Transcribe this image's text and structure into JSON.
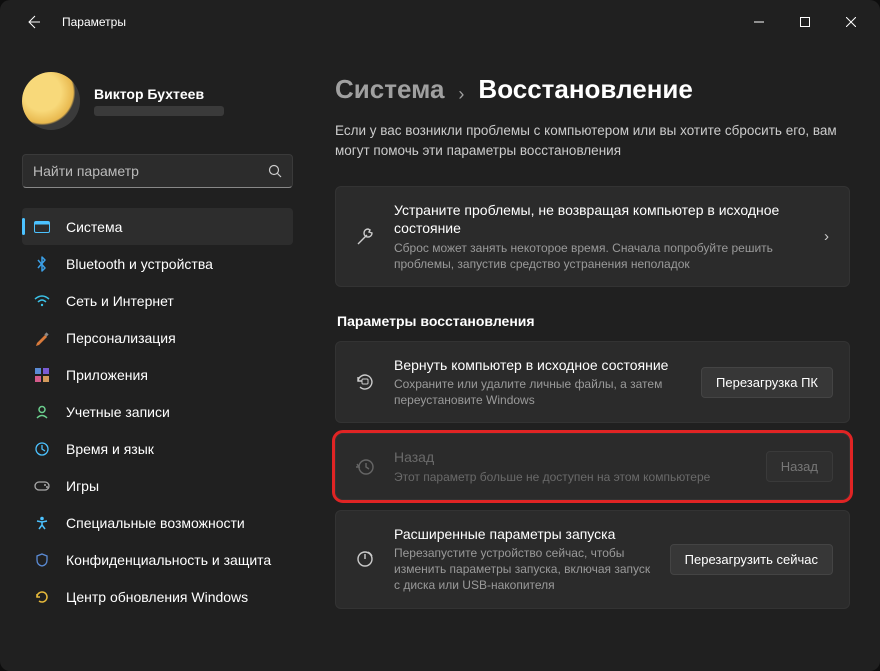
{
  "titlebar": {
    "app_title": "Параметры"
  },
  "profile": {
    "username": "Виктор Бухтеев"
  },
  "search": {
    "placeholder": "Найти параметр"
  },
  "nav": {
    "items": [
      {
        "label": "Система"
      },
      {
        "label": "Bluetooth и устройства"
      },
      {
        "label": "Сеть и Интернет"
      },
      {
        "label": "Персонализация"
      },
      {
        "label": "Приложения"
      },
      {
        "label": "Учетные записи"
      },
      {
        "label": "Время и язык"
      },
      {
        "label": "Игры"
      },
      {
        "label": "Специальные возможности"
      },
      {
        "label": "Конфиденциальность и защита"
      },
      {
        "label": "Центр обновления Windows"
      }
    ]
  },
  "breadcrumb": {
    "parent": "Система",
    "current": "Восстановление"
  },
  "intro": "Если у вас возникли проблемы с компьютером или вы хотите сбросить его, вам могут помочь эти параметры восстановления",
  "troubleshoot": {
    "title": "Устраните проблемы, не возвращая компьютер в исходное состояние",
    "sub": "Сброс может занять некоторое время. Сначала попробуйте решить проблемы, запустив средство устранения неполадок"
  },
  "section_header": "Параметры восстановления",
  "reset": {
    "title": "Вернуть компьютер в исходное состояние",
    "sub": "Сохраните или удалите личные файлы, а затем переустановите Windows",
    "button": "Перезагрузка ПК"
  },
  "goback": {
    "title": "Назад",
    "sub": "Этот параметр больше не доступен на этом компьютере",
    "button": "Назад"
  },
  "advanced": {
    "title": "Расширенные параметры запуска",
    "sub": "Перезапустите устройство сейчас, чтобы изменить параметры запуска, включая запуск с диска или USB-накопителя",
    "button": "Перезагрузить сейчас"
  }
}
